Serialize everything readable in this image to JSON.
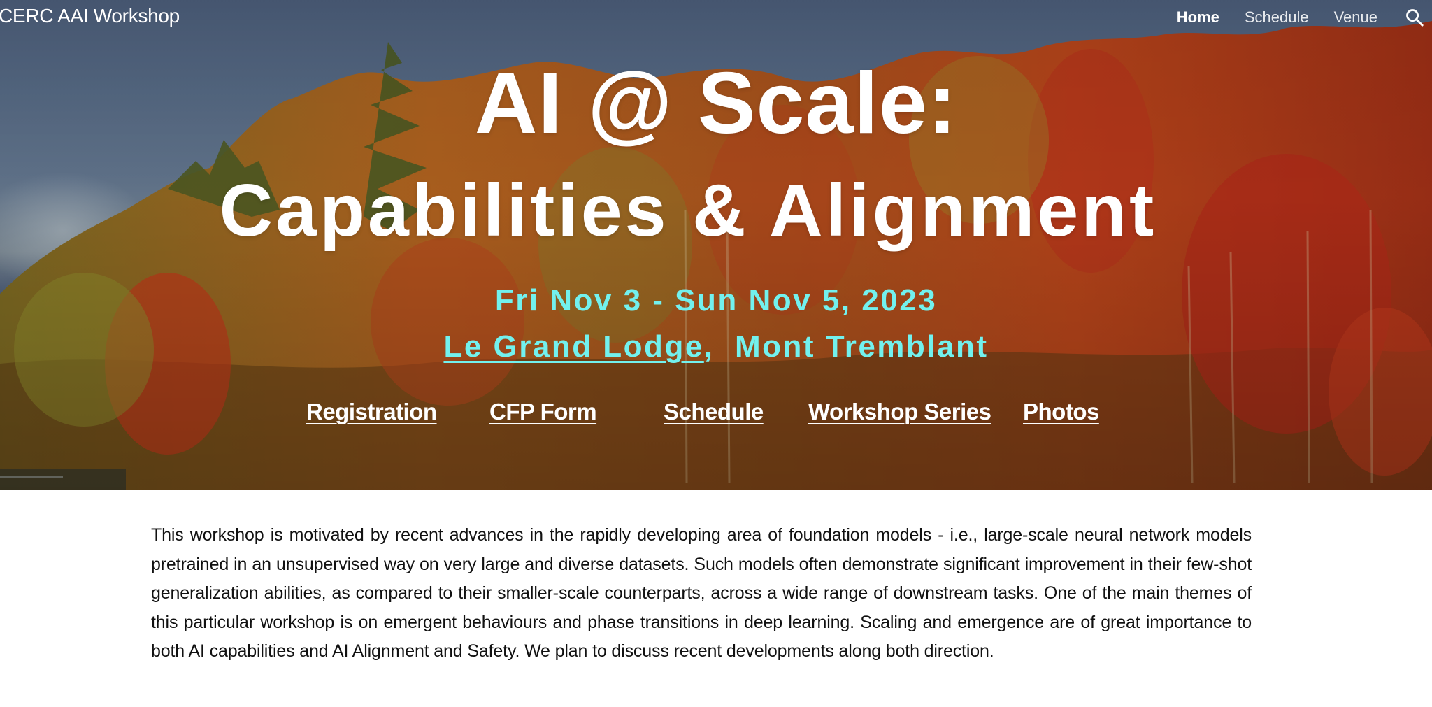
{
  "header": {
    "site_title": "CERC AAI Workshop",
    "nav": [
      {
        "label": "Home",
        "active": true
      },
      {
        "label": "Schedule",
        "active": false
      },
      {
        "label": "Venue",
        "active": false
      }
    ],
    "search_icon": "search-icon"
  },
  "hero": {
    "title_line1": "AI @ Scale:",
    "title_line2": "Capabilities & Alignment",
    "dates": "Fri Nov 3 - Sun Nov 5, 2023",
    "venue_link": "Le Grand Lodge",
    "venue_separator": ",",
    "venue_location": "Mont Tremblant",
    "links": [
      {
        "label": "Registration"
      },
      {
        "label": "CFP Form"
      },
      {
        "label": "Schedule"
      },
      {
        "label": "Workshop Series"
      },
      {
        "label": "Photos"
      }
    ],
    "accent_color": "#72f1ee"
  },
  "intro": {
    "paragraph": "This workshop is  motivated by recent advances in the rapidly developing area of foundation models - i.e., large-scale neural network models pretrained in an unsupervised way on very large and diverse datasets. Such models often demonstrate significant improvement in their few-shot generalization abilities, as compared to their smaller-scale counterparts, across a wide range of downstream tasks. One of the main themes  of this particular workshop is on emergent behaviours and phase transitions in deep learning.  Scaling and emergence are of great importance to both AI capabilities and AI Alignment and Safety. We plan to discuss recent developments along both direction."
  }
}
